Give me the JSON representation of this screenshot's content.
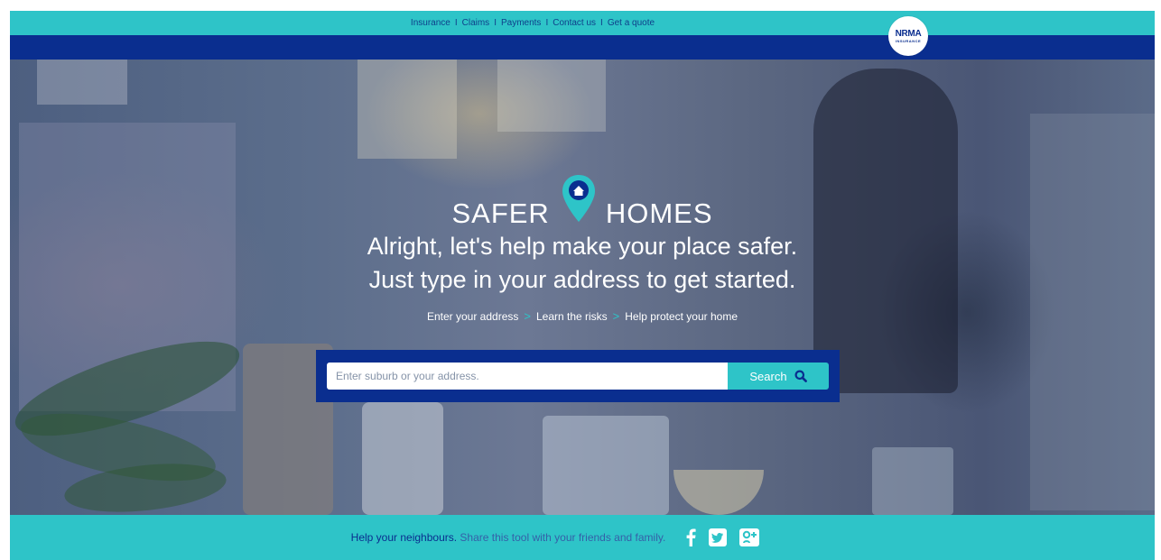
{
  "topnav": {
    "items": [
      "Insurance",
      "Claims",
      "Payments",
      "Contact us",
      "Get a quote"
    ],
    "separator": "I"
  },
  "logo": {
    "line1": "NRMA",
    "line2": "INSURANCE"
  },
  "hero": {
    "brand_left": "SAFER",
    "brand_right": "HOMES",
    "headline_1": "Alright, let's help make your place safer.",
    "headline_2": "Just type in your address to get started.",
    "steps": [
      "Enter your address",
      "Learn the risks",
      "Help protect your home"
    ],
    "step_separator": ">"
  },
  "search": {
    "placeholder": "Enter suburb or your address.",
    "button_label": "Search"
  },
  "footer": {
    "lead": "Help your neighbours.",
    "rest": "Share this tool with your friends and family.",
    "social": [
      "facebook-icon",
      "twitter-icon",
      "google-plus-icon"
    ]
  },
  "colors": {
    "teal": "#2ec4c8",
    "navy": "#0a2e8f"
  }
}
